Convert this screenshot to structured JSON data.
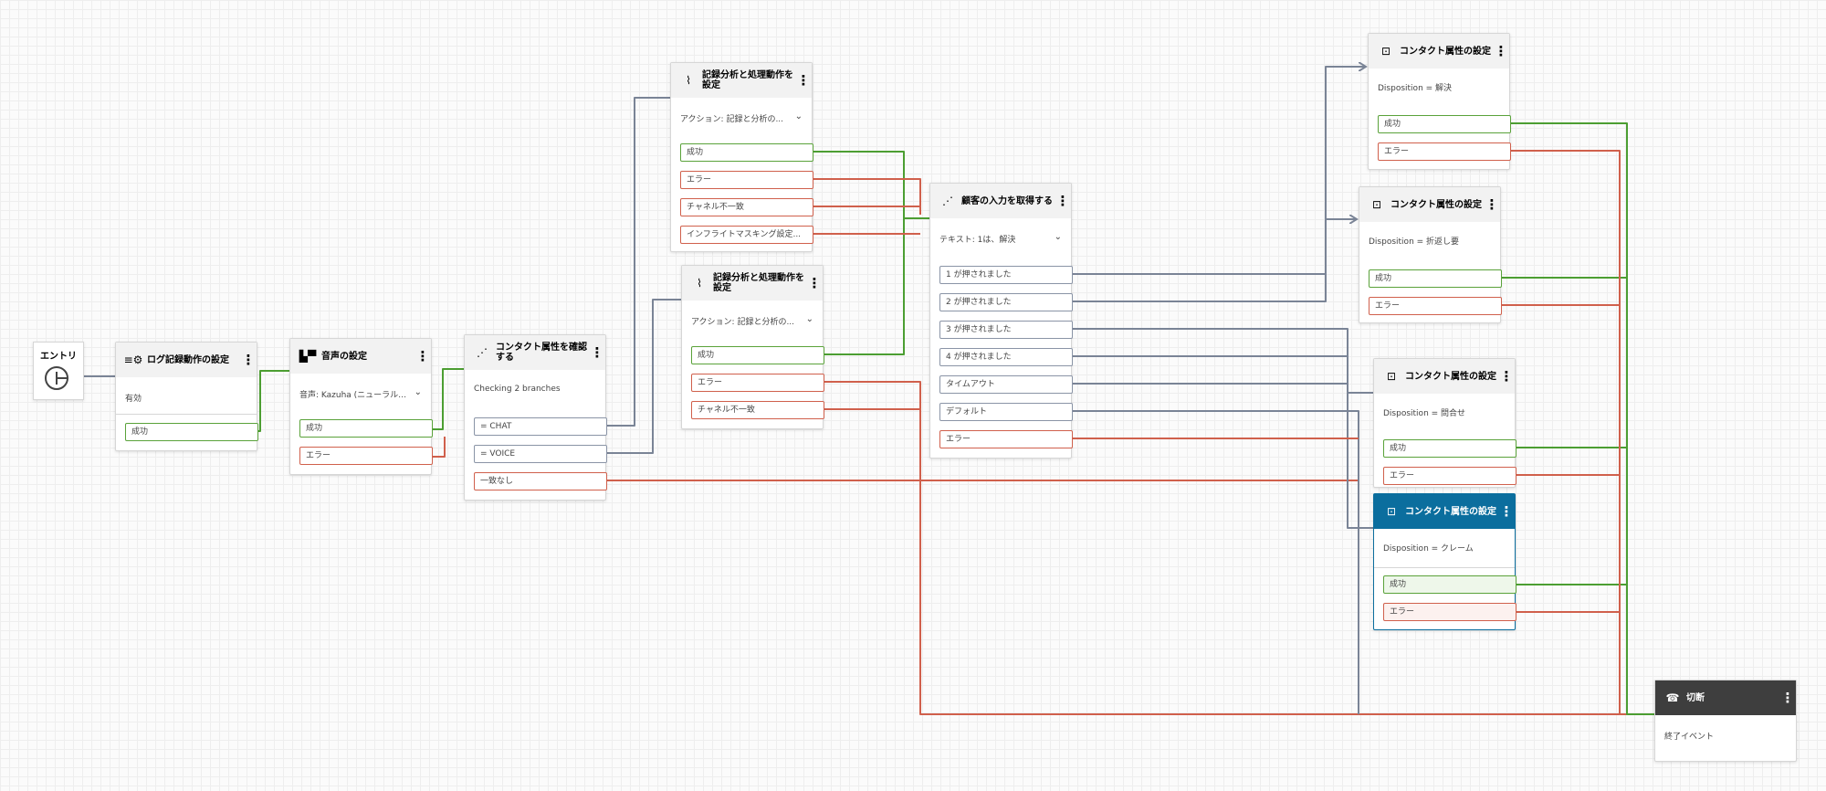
{
  "colors": {
    "ok_wire": "#4c9e32",
    "err_wire": "#d0604c",
    "neutral_wire": "#7a8496",
    "selected_header": "#0b6e9e",
    "disconnect_header": "#3e3e3e"
  },
  "entry": {
    "label": "エントリ"
  },
  "log": {
    "title": "ログ記録動作の設定",
    "icon": "log-settings-icon",
    "field": "有効",
    "ok": "成功"
  },
  "voice": {
    "title": "音声の設定",
    "icon": "voice-icon",
    "field": "音声: Kazuha (ニューラル)...",
    "ok": "成功",
    "err": "エラー"
  },
  "check_attr": {
    "title": "コンタクト属性を確認する",
    "icon": "check-attribute-icon",
    "field": "Checking 2 branches",
    "b1": "= CHAT",
    "b2": "= VOICE",
    "b3": "一致なし"
  },
  "rec1": {
    "title": "記録分析と処理動作を設定",
    "icon": "recording-icon",
    "field": "アクション: 記録と分析の...",
    "ok": "成功",
    "err": "エラー",
    "mismatch": "チャネル不一致",
    "masking": "インフライトマスキング設定..."
  },
  "rec2": {
    "title": "記録分析と処理動作を設定",
    "icon": "recording-icon",
    "field": "アクション: 記録と分析の...",
    "ok": "成功",
    "err": "エラー",
    "mismatch": "チャネル不一致"
  },
  "input": {
    "title": "顧客の入力を取得する",
    "icon": "customer-input-icon",
    "field": "テキスト: 1は、解決",
    "b1": "1 が押されました",
    "b2": "2 が押されました",
    "b3": "3 が押されました",
    "b4": "4 が押されました",
    "timeout": "タイムアウト",
    "default": "デフォルト",
    "err": "エラー"
  },
  "set1": {
    "title": "コンタクト属性の設定",
    "icon": "set-attribute-icon",
    "field": "Disposition = 解決",
    "ok": "成功",
    "err": "エラー"
  },
  "set2": {
    "title": "コンタクト属性の設定",
    "icon": "set-attribute-icon",
    "field": "Disposition = 折返し要",
    "ok": "成功",
    "err": "エラー"
  },
  "set3": {
    "title": "コンタクト属性の設定",
    "icon": "set-attribute-icon",
    "field": "Disposition = 問合せ",
    "ok": "成功",
    "err": "エラー"
  },
  "set4": {
    "title": "コンタクト属性の設定",
    "icon": "set-attribute-icon",
    "field": "Disposition = クレーム",
    "ok": "成功",
    "err": "エラー"
  },
  "disconnect": {
    "title": "切断",
    "icon": "disconnect-icon",
    "field": "終了イベント"
  }
}
